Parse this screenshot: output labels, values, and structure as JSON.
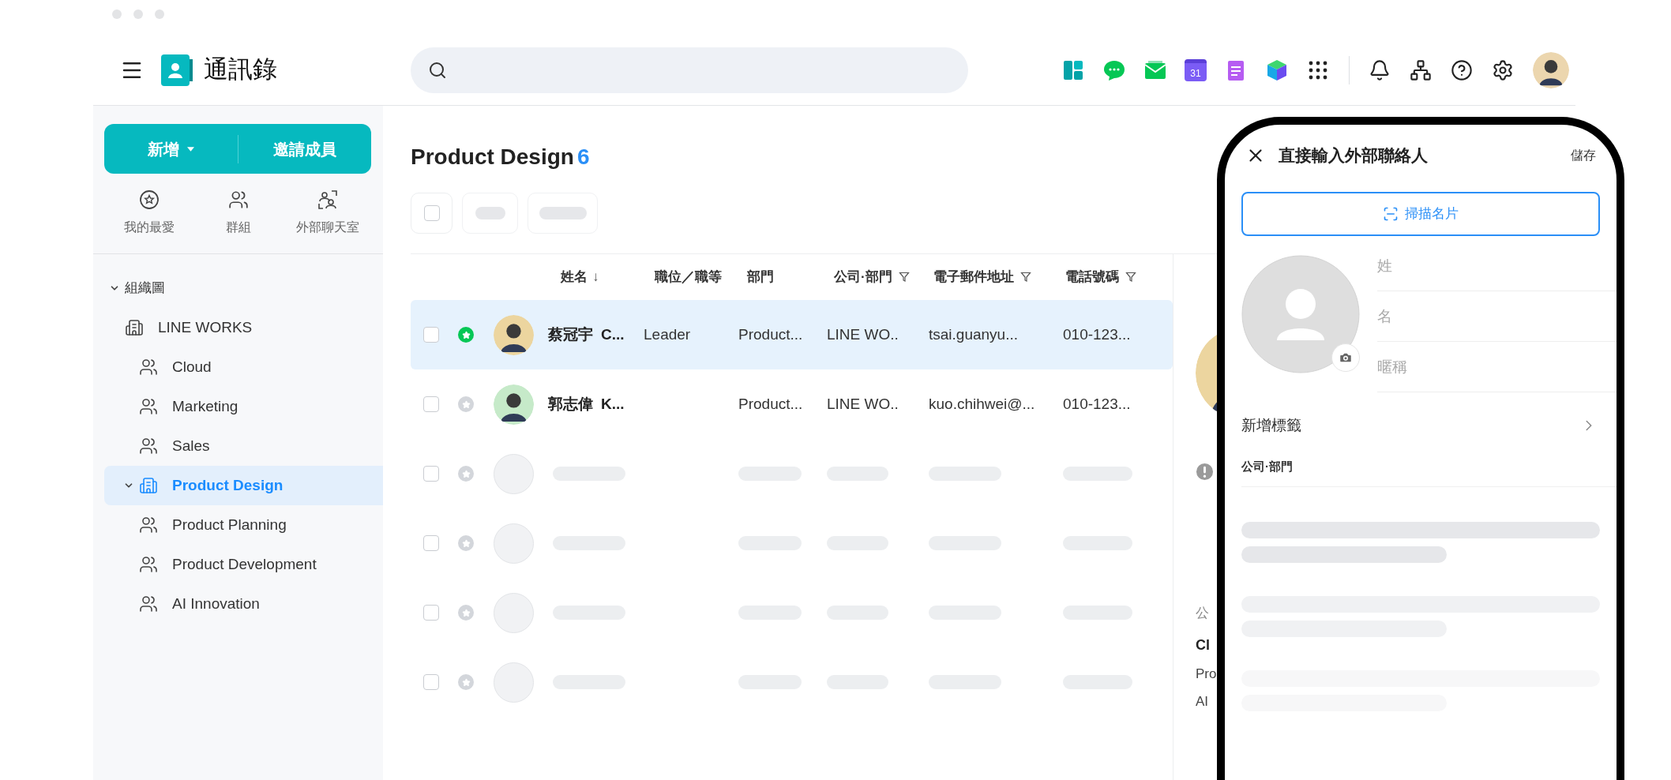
{
  "header": {
    "app_title": "通訊錄",
    "calendar_day": "31"
  },
  "sidebar": {
    "primary_buttons": [
      {
        "label": "新增",
        "kind": "dropdown"
      },
      {
        "label": "邀請成員",
        "kind": "plain"
      }
    ],
    "shortcuts": [
      {
        "label": "我的最愛",
        "kind": "favorites"
      },
      {
        "label": "群組",
        "kind": "groups"
      },
      {
        "label": "外部聊天室",
        "kind": "external"
      }
    ],
    "tree": [
      {
        "label": "組織圖",
        "expanded": true,
        "selected": false,
        "children": [
          {
            "label": "LINE WORKS",
            "kind": "company",
            "selected": false,
            "children": [
              {
                "label": "Cloud",
                "kind": "group",
                "selected": false
              },
              {
                "label": "Marketing",
                "kind": "group",
                "selected": false
              },
              {
                "label": "Sales",
                "kind": "group",
                "selected": false
              },
              {
                "label": "Product Design",
                "kind": "company",
                "expanded": true,
                "selected": true,
                "children": [
                  {
                    "label": "Product Planning",
                    "kind": "group",
                    "selected": false
                  },
                  {
                    "label": "Product Development",
                    "kind": "group",
                    "selected": false
                  },
                  {
                    "label": "AI Innovation",
                    "kind": "group",
                    "selected": false
                  }
                ]
              }
            ]
          }
        ]
      }
    ]
  },
  "main": {
    "title": "Product Design",
    "count": "6",
    "select_all": {
      "checked": false
    },
    "table": {
      "columns": [
        {
          "label": "姓名",
          "sort_icon": "↓",
          "filter": false
        },
        {
          "label": "職位／職等",
          "filter": false
        },
        {
          "label": "部門",
          "filter": false
        },
        {
          "label": "公司·部門",
          "filter": true
        },
        {
          "label": "電子郵件地址",
          "filter": true
        },
        {
          "label": "電話號碼",
          "filter": true
        }
      ],
      "rows": [
        {
          "kind": "contact",
          "selected": true,
          "checked": false,
          "favorite": true,
          "name": "蔡冠宇",
          "english_name": "C...",
          "position": "Leader",
          "department": "Product...",
          "company": "LINE WO..",
          "email": "tsai.guanyu...",
          "phone": "010-123..."
        },
        {
          "kind": "contact",
          "selected": false,
          "checked": false,
          "favorite": false,
          "name": "郭志偉",
          "english_name": "K...",
          "department": "Product...",
          "company": "LINE WO..",
          "email": "kuo.chihwei@...",
          "phone": "010-123..."
        },
        {
          "kind": "loading",
          "selected": false,
          "checked": false,
          "favorite": false
        },
        {
          "kind": "loading",
          "selected": false,
          "checked": false,
          "favorite": false
        },
        {
          "kind": "loading",
          "selected": false,
          "checked": false,
          "favorite": false
        },
        {
          "kind": "loading",
          "selected": false,
          "checked": false,
          "favorite": false
        }
      ]
    }
  },
  "detail_panel": {
    "section_label": "公",
    "name": "Cl",
    "lines": [
      "Pro",
      "AI"
    ]
  },
  "phone_form": {
    "title": "直接輸入外部聯絡人",
    "save": "儲存",
    "scan_button": "掃描名片",
    "fields": [
      {
        "placeholder": "姓"
      },
      {
        "placeholder": "名"
      },
      {
        "placeholder": "暱稱"
      }
    ],
    "add_tag": "新增標籤",
    "company_label": "公司·部門"
  }
}
